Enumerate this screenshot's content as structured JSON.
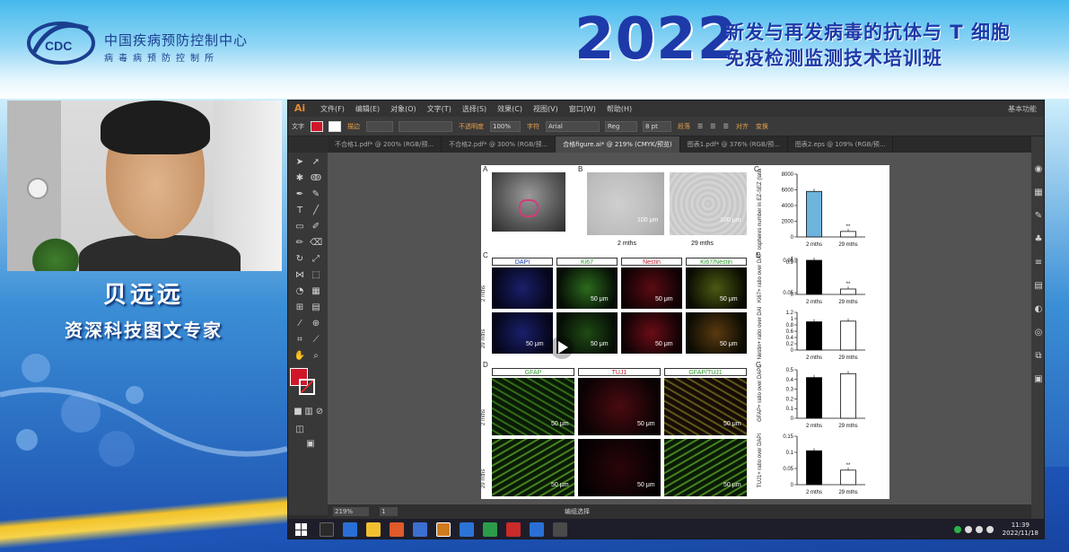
{
  "banner": {
    "org_name": "中国疾病预防控制中心",
    "org_sub": "病毒病预防控制所",
    "logo_text": "CDC",
    "year": "2022",
    "title_line1": "新发与再发病毒的抗体与 T 细胞",
    "title_line2": "免疫检测监测技术培训班"
  },
  "presenter": {
    "name": "贝远远",
    "title": "资深科技图文专家"
  },
  "app": {
    "logo": "Ai",
    "menu": [
      "文件(F)",
      "编辑(E)",
      "对象(O)",
      "文字(T)",
      "选择(S)",
      "效果(C)",
      "视图(V)",
      "窗口(W)",
      "帮助(H)"
    ],
    "menu_right": "基本功能",
    "control_bar": {
      "mode": "文字",
      "stroke_label": "描边",
      "opacity_label": "不透明度",
      "opacity_value": "100%",
      "char_label": "字符",
      "font_value": "Arial",
      "style_value": "Reg",
      "size_value": "8 pt",
      "para_label": "段落",
      "align_label": "对齐",
      "transform_label": "变换"
    },
    "tabs": [
      "不合格1.pdf* @ 200% (RGB/预...",
      "不合格2.pdf* @ 300% (RGB/预...",
      "合格figure.ai* @ 219% (CMYK/预览)",
      "图表1.pdf* @ 376% (RGB/预...",
      "图表2.eps @ 109% (RGB/预..."
    ],
    "active_tab": 2,
    "status": {
      "zoom": "219%",
      "page": "1",
      "mode_text": "编组选择"
    },
    "fill_color": "#d0172a"
  },
  "taskbar": {
    "time": "11:39",
    "date": "2022/11/18"
  },
  "figure": {
    "panel_letters": [
      "A",
      "B",
      "C",
      "D",
      "E",
      "F",
      "G"
    ],
    "b_labels": [
      "2 mths",
      "29 mths"
    ],
    "b_scale": "100 μm",
    "c_headers": [
      "DAPI",
      "Ki67",
      "Nestin",
      "Ki67/Nestin"
    ],
    "d_headers": [
      "GFAP",
      "TUJ1",
      "GFAP/TUJ1"
    ],
    "row_labels": [
      "2 mths",
      "29 mths"
    ],
    "scale_50": "50 μm",
    "sig": "**"
  },
  "chart_data": [
    {
      "type": "bar",
      "panel": "C (right)",
      "ylabel": "Neurospheres number in EZ-SEZ (lateral slice)",
      "categories": [
        "2 mths",
        "29 mths"
      ],
      "values": [
        5800,
        700
      ],
      "ylim": [
        0,
        8000
      ],
      "yticks": [
        0,
        2000,
        4000,
        6000,
        8000
      ],
      "colors": [
        "#6fb4dd",
        "#ffffff"
      ],
      "annotation": "**"
    },
    {
      "type": "bar",
      "panel": "E",
      "ylabel": "Ki67+ ratio over DAPI",
      "categories": [
        "2 mths",
        "29 mths"
      ],
      "values": [
        0.95,
        0.15
      ],
      "ylim": [
        0,
        1.0
      ],
      "yticks": [
        0.0,
        0.05,
        0.9,
        0.95,
        1.0
      ],
      "annotation": "**"
    },
    {
      "type": "bar",
      "panel": "E (lower)",
      "ylabel": "Nestin+ ratio over DAPI",
      "categories": [
        "2 mths",
        "29 mths"
      ],
      "values": [
        0.9,
        0.92
      ],
      "ylim": [
        0,
        1.2
      ],
      "yticks": [
        0.0,
        0.2,
        0.4,
        0.6,
        0.8,
        1.0,
        1.2
      ]
    },
    {
      "type": "bar",
      "panel": "G",
      "ylabel": "GFAP+ ratio over DAPI",
      "categories": [
        "2 mths",
        "29 mths"
      ],
      "values": [
        0.42,
        0.46
      ],
      "ylim": [
        0,
        0.5
      ],
      "yticks": [
        0.0,
        0.1,
        0.2,
        0.3,
        0.4,
        0.5
      ]
    },
    {
      "type": "bar",
      "panel": "G (lower)",
      "ylabel": "TUJ1+ ratio over DAPI",
      "categories": [
        "2 mths",
        "29 mths"
      ],
      "values": [
        0.105,
        0.045
      ],
      "ylim": [
        0,
        0.15
      ],
      "yticks": [
        0.0,
        0.05,
        0.1,
        0.15
      ],
      "annotation": "**"
    }
  ]
}
